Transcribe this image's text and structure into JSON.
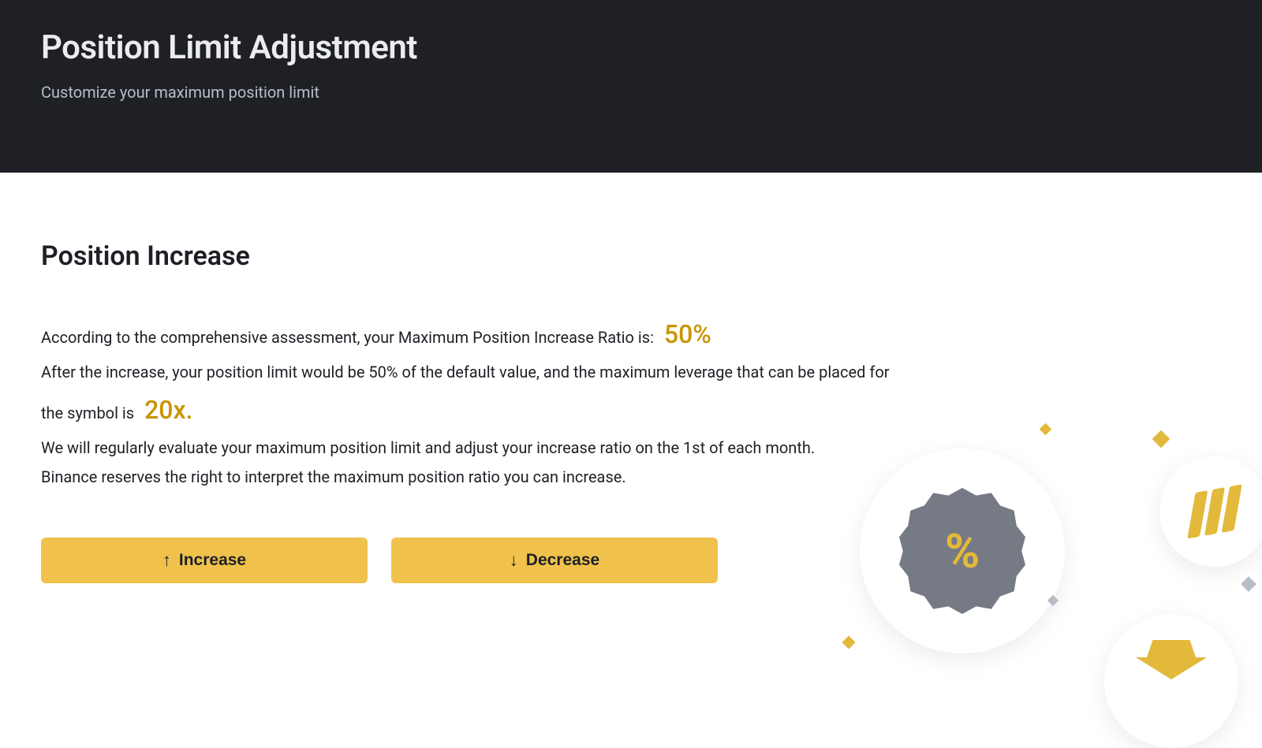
{
  "header": {
    "title": "Position Limit Adjustment",
    "subtitle": "Customize your maximum position limit"
  },
  "section": {
    "title": "Position Increase",
    "ratio_label": "According to the comprehensive assessment, your Maximum Position Increase Ratio is:",
    "ratio_value": "50%",
    "after_text_1": "After the increase, your position limit would be 50% of the default value, and the maximum leverage that can be placed for",
    "after_text_2": "the symbol is",
    "leverage_value": "20x.",
    "note1": "We will regularly evaluate your maximum position limit and adjust your increase ratio on the 1st of each month.",
    "note2": "Binance reserves the right to interpret the maximum position ratio you can increase."
  },
  "buttons": {
    "increase": "Increase",
    "decrease": "Decrease"
  },
  "icons": {
    "arrow_up": "↑",
    "arrow_down": "↓",
    "percent": "%"
  }
}
